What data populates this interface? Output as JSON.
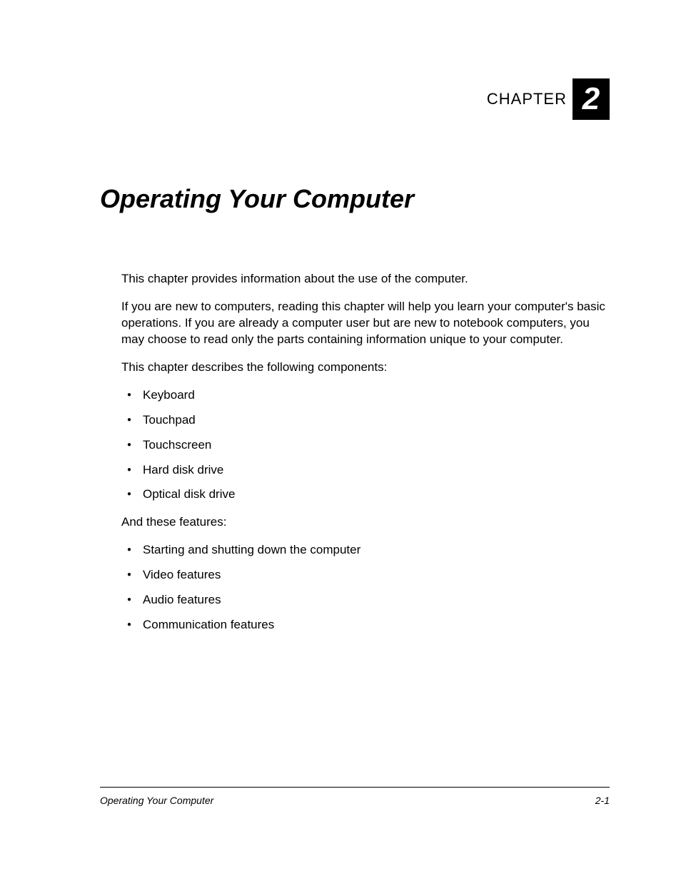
{
  "header": {
    "chapter_label": "CHAPTER",
    "chapter_number": "2"
  },
  "title": "Operating Your Computer",
  "paragraphs": {
    "p1": "This chapter provides information about the use of the computer.",
    "p2": "If you are new to computers, reading this chapter will help you learn your computer's basic operations. If you are already a computer user but are new to notebook computers, you may choose to read only the parts containing information unique to your computer.",
    "p3": "This chapter describes the following components:",
    "p4": "And these features:"
  },
  "components_list": [
    "Keyboard",
    "Touchpad",
    "Touchscreen",
    "Hard disk drive",
    "Optical disk drive"
  ],
  "features_list": [
    "Starting and shutting down the computer",
    "Video features",
    "Audio features",
    "Communication features"
  ],
  "footer": {
    "left": "Operating Your Computer",
    "right": "2-1"
  }
}
